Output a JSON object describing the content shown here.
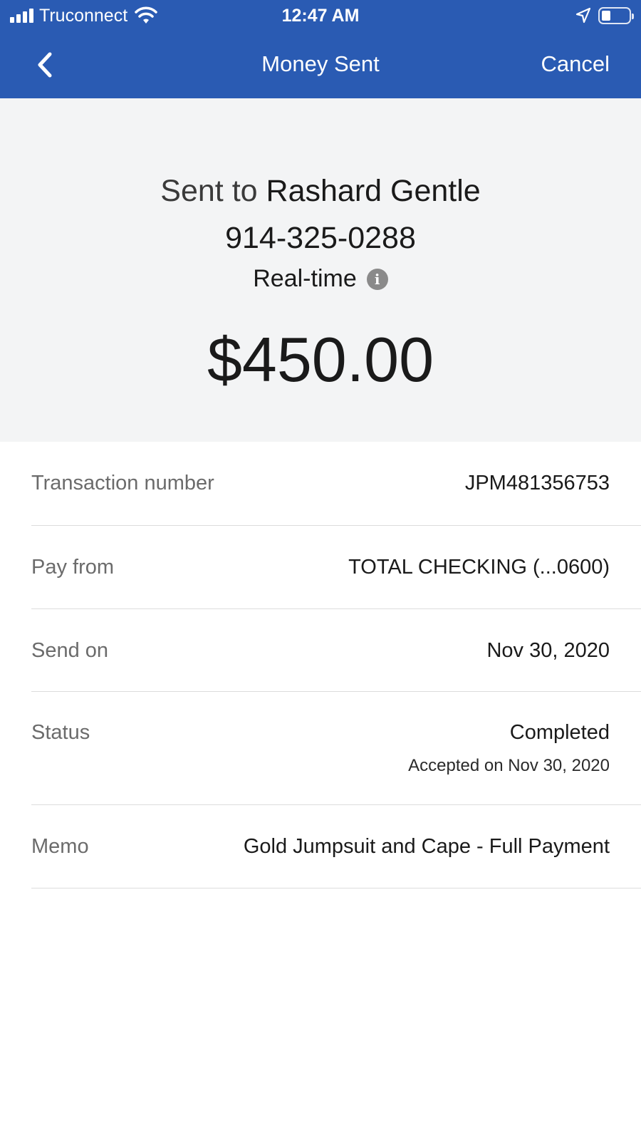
{
  "status_bar": {
    "carrier": "Truconnect",
    "time": "12:47 AM"
  },
  "nav": {
    "title": "Money Sent",
    "cancel_label": "Cancel",
    "back_icon": "chevron-left-icon"
  },
  "summary": {
    "sent_prefix": "Sent to",
    "recipient_name": "Rashard Gentle",
    "phone": "914-325-0288",
    "speed": "Real-time",
    "amount": "$450.00"
  },
  "details": {
    "transaction": {
      "label": "Transaction number",
      "value": "JPM481356753"
    },
    "pay_from": {
      "label": "Pay from",
      "value": "TOTAL CHECKING (...0600)"
    },
    "send_on": {
      "label": "Send on",
      "value": "Nov 30, 2020"
    },
    "status": {
      "label": "Status",
      "value": "Completed",
      "sub": "Accepted on Nov 30, 2020"
    },
    "memo": {
      "label": "Memo",
      "value": "Gold Jumpsuit and Cape - Full Payment"
    }
  },
  "colors": {
    "header_bg": "#2a5bb3",
    "summary_bg": "#f3f4f5"
  }
}
